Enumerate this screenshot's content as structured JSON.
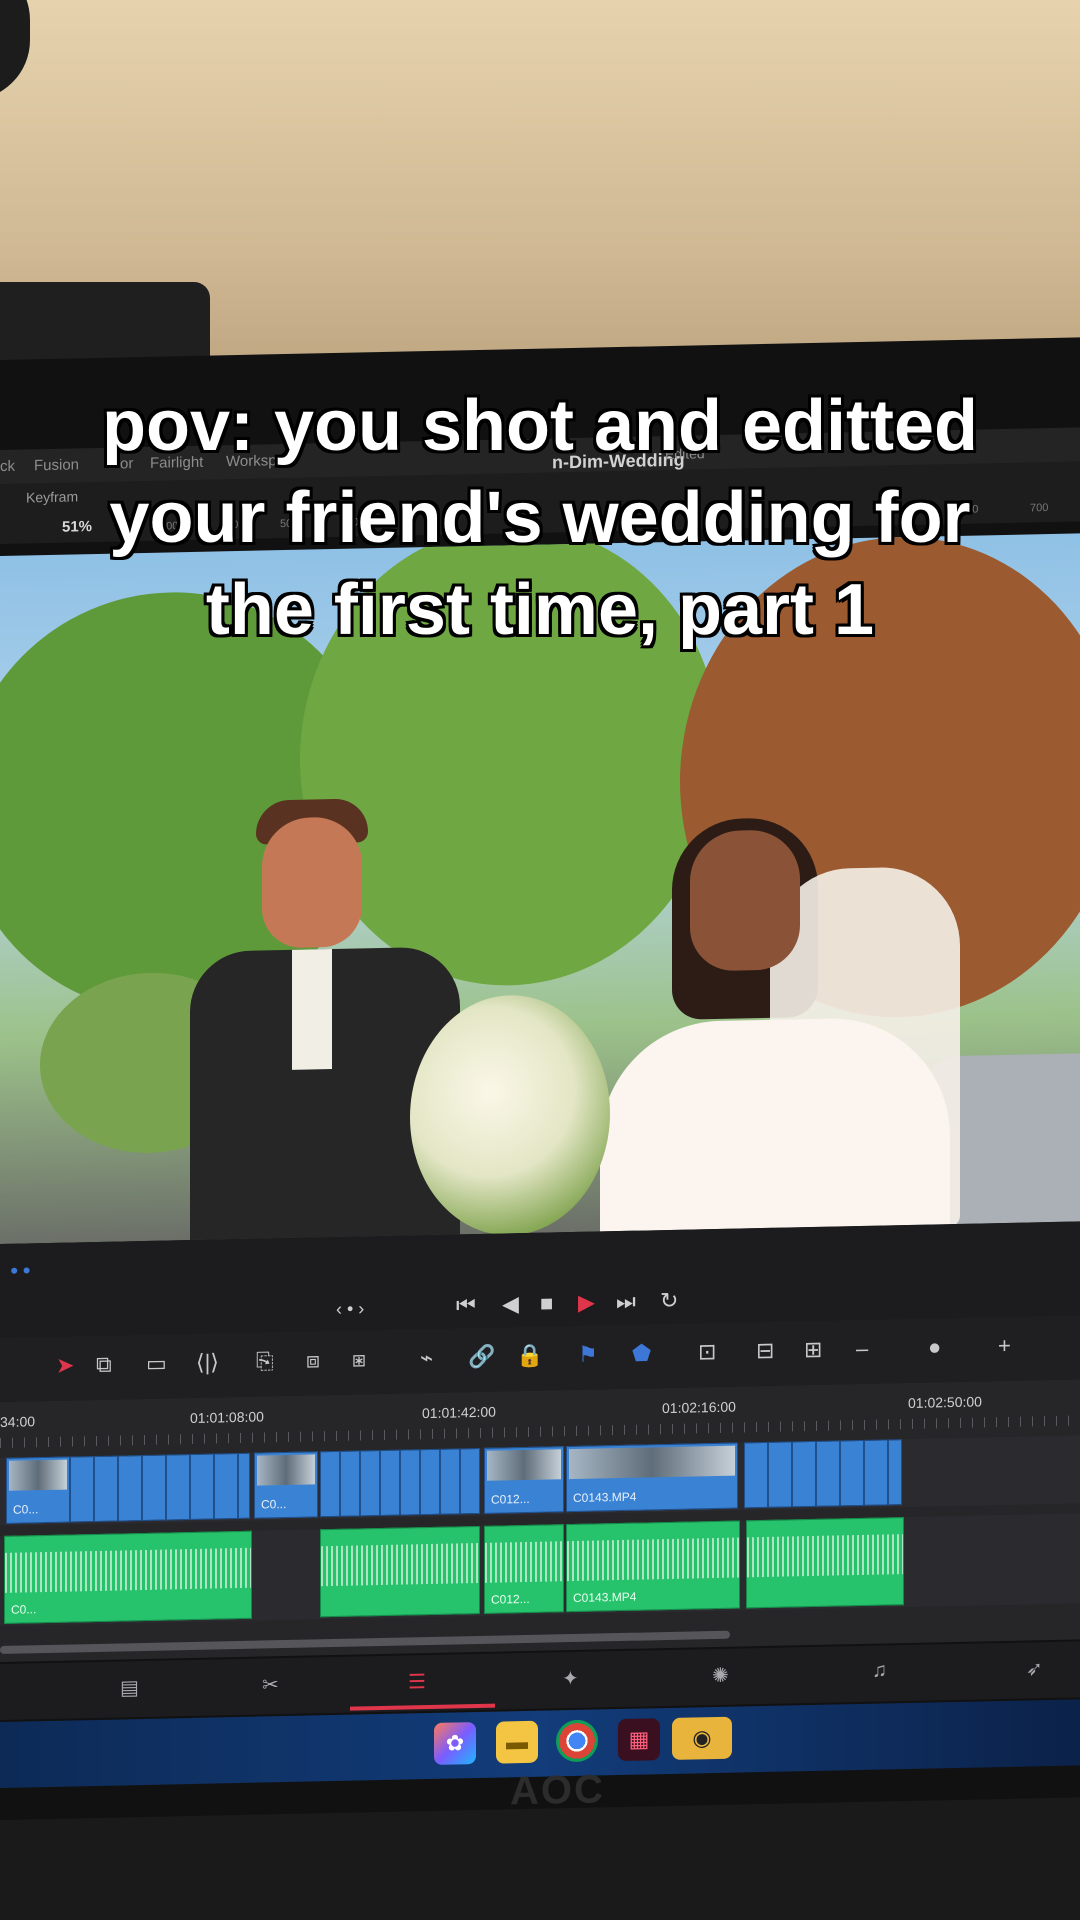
{
  "caption": {
    "line1": "pov: you shot and editted",
    "line2": "your friend's wedding for",
    "line3": "the first time, part 1"
  },
  "app": {
    "page_tabs": [
      "ck",
      "Fusion",
      "or",
      "Fairlight",
      "Worksp"
    ],
    "project_title": "n-Dim-Wedding",
    "project_status": "Edited",
    "keyframe_label": "Keyfram",
    "zoom_level": "51%",
    "ruler_labels": [
      "700",
      "600",
      "500",
      "400",
      "600",
      "700"
    ]
  },
  "transport": {
    "buttons": [
      "⏮",
      "◀",
      "■",
      "▶",
      "⏭",
      "↻"
    ],
    "nav": "‹ • ›"
  },
  "timeline": {
    "timecodes": [
      "34:00",
      "01:01:08:00",
      "01:01:42:00",
      "01:02:16:00",
      "01:02:50:00"
    ],
    "video_clips": [
      {
        "label": "C0...",
        "kind": "thumb"
      },
      {
        "label": "",
        "kind": "plain"
      },
      {
        "label": "C0...",
        "kind": "thumb"
      },
      {
        "label": "",
        "kind": "plain"
      },
      {
        "label": "C012...",
        "kind": "thumb"
      },
      {
        "label": "C0143.MP4",
        "kind": "thumb"
      },
      {
        "label": "",
        "kind": "plain"
      }
    ],
    "audio_clips": [
      {
        "label": "C0..."
      },
      {
        "label": ""
      },
      {
        "label": "C012..."
      },
      {
        "label": "C0143.MP4"
      },
      {
        "label": ""
      }
    ]
  },
  "colors": {
    "video_clip": "#3a82d4",
    "audio_clip": "#26c26c",
    "playhead_accent": "#e0364b",
    "play_button": "#e0364b"
  },
  "icons": {
    "page_nav": [
      "media-page-icon",
      "cut-page-icon",
      "edit-page-icon",
      "fusion-page-icon",
      "color-page-icon",
      "fairlight-page-icon",
      "deliver-page-icon"
    ],
    "taskbar": [
      "copilot-icon",
      "file-explorer-icon",
      "chrome-icon",
      "app-icon",
      "davinci-resolve-icon"
    ]
  },
  "monitor_brand": "AOC"
}
